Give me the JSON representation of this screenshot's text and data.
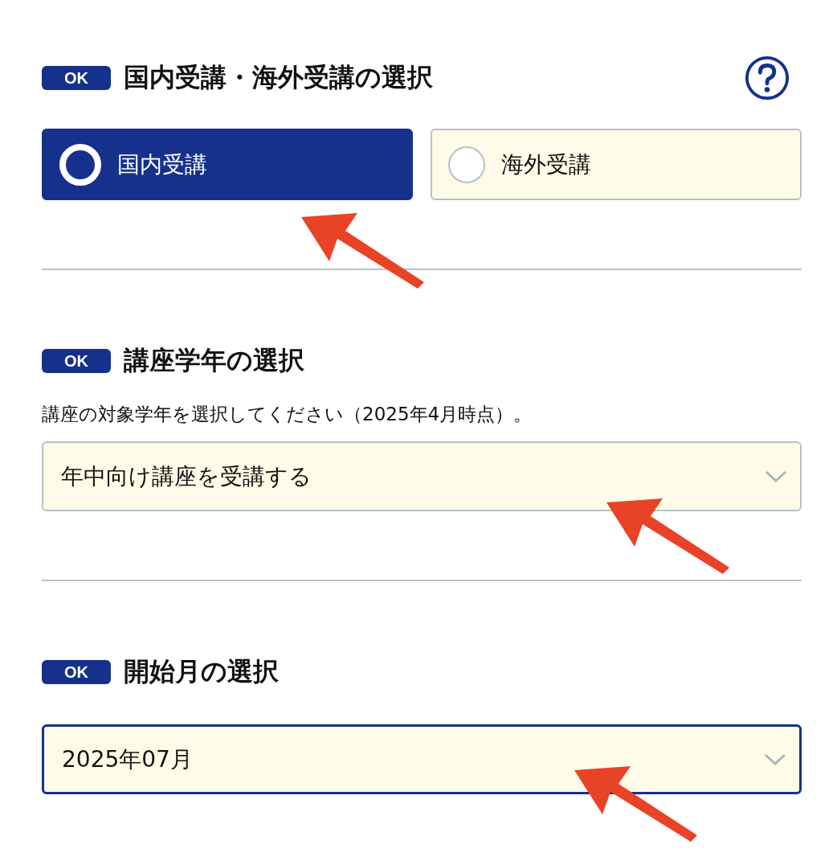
{
  "sections": [
    {
      "badge": "OK",
      "title": "国内受講・海外受講の選択",
      "help": true,
      "kind": "radios",
      "options": [
        {
          "label": "国内受講",
          "selected": true
        },
        {
          "label": "海外受講",
          "selected": false
        }
      ]
    },
    {
      "badge": "OK",
      "title": "講座学年の選択",
      "help": false,
      "kind": "select",
      "hint": "講座の対象学年を選択してください（2025年4月時点）。",
      "value": "年中向け講座を受講する",
      "focused": false
    },
    {
      "badge": "OK",
      "title": "開始月の選択",
      "help": false,
      "kind": "select",
      "value": "2025年07月",
      "focused": true
    }
  ],
  "annotations": [
    {
      "kind": "arrow"
    },
    {
      "kind": "arrow"
    },
    {
      "kind": "arrow"
    }
  ]
}
